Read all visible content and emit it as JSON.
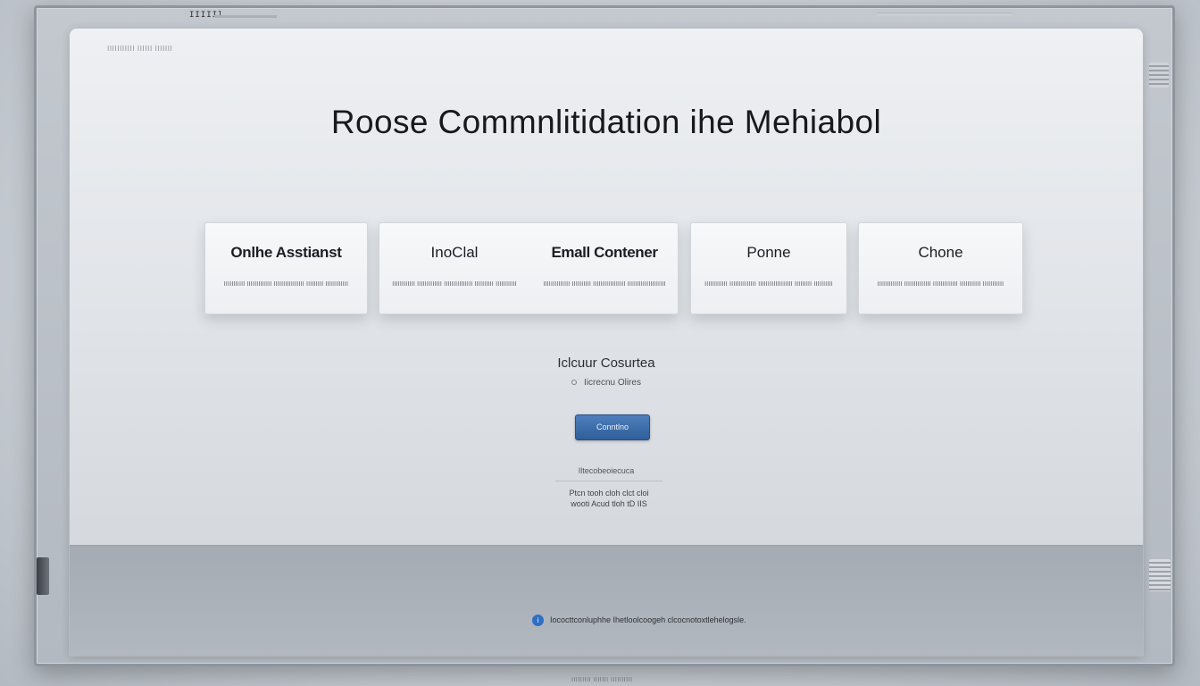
{
  "frame": {
    "top_label": "IIIIIl",
    "bottom_caption": "IIIIIIIII IIIIIII IIIIIIIIII"
  },
  "window": {
    "label": "IIIIIIIIIII IIIIII IIIIIII",
    "title": "Roose Commnlitidation ihe Mehiabol"
  },
  "cards": [
    {
      "title": "Onlhe Asstianst",
      "desc": "IIIIIIIIIII IIIIIIIIIIIII IIIIIIIIIIIIIIII IIIIIIIII IIIIIIIIIIII"
    },
    {
      "title": "InoClal",
      "desc": "IIIIIIIIIIII IIIIIIIIIIIII IIIIIIIIIIIIIII IIIIIIIIII IIIIIIIIIII"
    },
    {
      "title": "Emall Contener",
      "desc": "IIIIIIIIIIIIII IIIIIIIIII IIIIIIIIIIIIIIIII IIIIIIIIIIIIIIIIIIII"
    },
    {
      "title": "Ponne",
      "desc": "IIIIIIIIIIII IIIIIIIIIIIIII IIIIIIIIIIIIIIIIII IIIIIIIII IIIIIIIIII"
    },
    {
      "title": "Chone",
      "desc": "IIIIIIIIIIIII IIIIIIIIIIIIII IIIIIIIIIIIII IIIIIIIIIII IIIIIIIIIII"
    }
  ],
  "helper": {
    "title": "Iclcuur Cosurtea",
    "sub": "Iicrecnu Olires"
  },
  "continue": {
    "label": "Conntlno"
  },
  "note": {
    "heading": "Iltecobeoiecuca",
    "line1": "Ptcn tooh cloh clct cloi",
    "line2": "wooti Acud tloh tD IIS"
  },
  "footer": {
    "info_icon": "i",
    "text": "Iococttconluphhe Ihetloolcoogeh clcocnotoxtlehelogsle."
  }
}
